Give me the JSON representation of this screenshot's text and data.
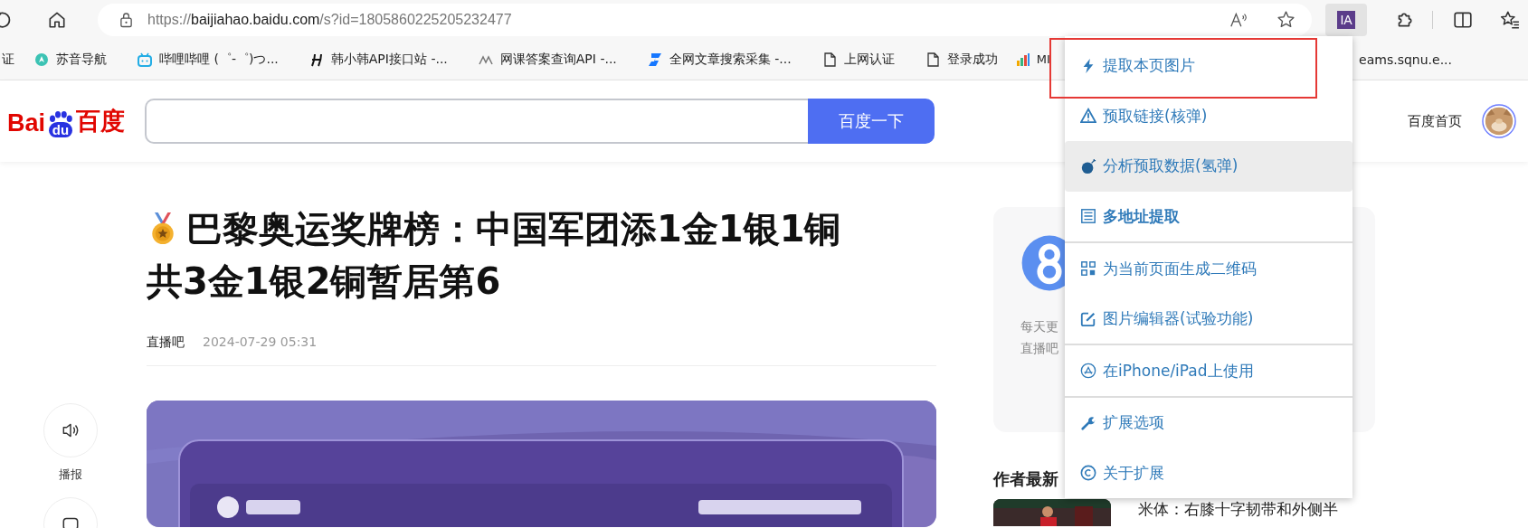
{
  "toolbar": {
    "url": {
      "scheme": "https://",
      "host": "baijiahao.baidu.com",
      "path": "/s?id=1805860225205232477"
    },
    "extension_button": {
      "label": "IA",
      "selected": true
    }
  },
  "bookmarks": [
    {
      "label": "证"
    },
    {
      "label": "苏音导航"
    },
    {
      "label": "哔哩哔哩 (゜-゜)つ..."
    },
    {
      "label": "韩小韩API接口站 -..."
    },
    {
      "label": "网课答案查询API -..."
    },
    {
      "label": "全网文章搜索采集 -..."
    },
    {
      "label": "上网认证"
    },
    {
      "label": "登录成功"
    },
    {
      "label": "MI"
    },
    {
      "label": "eams.sqnu.e..."
    }
  ],
  "header": {
    "logo": {
      "left": "Bai",
      "mark": "du",
      "right": "百度"
    },
    "search_button": "百度一下",
    "home_link": "百度首页"
  },
  "article": {
    "title_lines": [
      "巴黎奥运奖牌榜：中国军团添1金1银1铜",
      "共3金1银2铜暂居第6"
    ],
    "author": "直播吧",
    "date": "2024-07-29 05:31",
    "listen_label": "播报"
  },
  "side_card": {
    "lines": [
      "每天更",
      "直播吧"
    ],
    "latest_heading": "作者最新",
    "latest_title": "米体：右膝十字韧带和外侧半"
  },
  "menu": {
    "groups": [
      [
        {
          "label": "提取本页图片",
          "selected": false,
          "bold": false
        },
        {
          "label": "预取链接(核弹)",
          "selected": false,
          "bold": false
        },
        {
          "label": "分析预取数据(氢弹)",
          "selected": true,
          "bold": false
        },
        {
          "label": "多地址提取",
          "selected": false,
          "bold": true
        }
      ],
      [
        {
          "label": "为当前页面生成二维码",
          "selected": false,
          "bold": false
        },
        {
          "label": "图片编辑器(试验功能)",
          "selected": false,
          "bold": false
        }
      ],
      [
        {
          "label": "在iPhone/iPad上使用",
          "selected": false,
          "bold": false
        }
      ],
      [
        {
          "label": "扩展选项",
          "selected": false,
          "bold": false
        },
        {
          "label": "关于扩展",
          "selected": false,
          "bold": false
        }
      ]
    ]
  }
}
